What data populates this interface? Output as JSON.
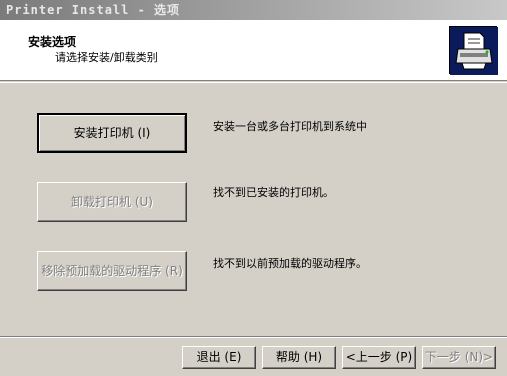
{
  "window": {
    "title": "Printer Install - 选项"
  },
  "header": {
    "title": "安装选项",
    "subtitle": "请选择安装/卸载类别",
    "icon": "printer-install-icon"
  },
  "options": [
    {
      "label": "安装打印机 (I)",
      "description": "安装一台或多台打印机到系统中",
      "enabled": true
    },
    {
      "label": "卸载打印机 (U)",
      "description": "找不到已安装的打印机。",
      "enabled": false
    },
    {
      "label": "移除预加载的驱动程序 (R)",
      "description": "找不到以前预加载的驱动程序。",
      "enabled": false
    }
  ],
  "footer": {
    "exit_label": "退出 (E)",
    "help_label": "帮助 (H)",
    "back_label": "<上一步 (P)",
    "next_label": "下一步 (N)>",
    "next_enabled": false
  }
}
